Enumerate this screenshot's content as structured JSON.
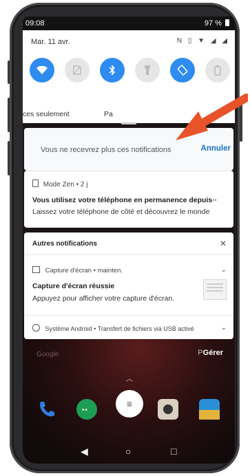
{
  "status_bar": {
    "time": "09:08",
    "battery": "97 %"
  },
  "quick_settings": {
    "date": "Mar. 11 avr.",
    "tiles": [
      {
        "name": "wifi",
        "icon": "wifi-icon",
        "state": "on"
      },
      {
        "name": "sim",
        "icon": "sim-icon",
        "state": "off"
      },
      {
        "name": "bluetooth",
        "icon": "bluetooth-icon",
        "state": "on"
      },
      {
        "name": "flashlight",
        "icon": "flashlight-icon",
        "state": "off"
      },
      {
        "name": "auto-rotate",
        "icon": "rotate-icon",
        "state": "on"
      },
      {
        "name": "battery-saver",
        "icon": "battery-saver-icon",
        "state": "off"
      }
    ],
    "labels": [
      "ces seulement",
      "Pa"
    ]
  },
  "muted_notification": {
    "message": "Vous ne recevrez plus ces notifications",
    "undo_label": "Annuler"
  },
  "zen_notification": {
    "app": "Mode Zen",
    "time": "2 j",
    "title": "Vous utilisez votre téléphone en permanence depuis··",
    "body": "Laissez votre téléphone de côté et découvrez le monde"
  },
  "other_notifications": {
    "header": "Autres notifications",
    "screenshot": {
      "app": "Capture d'écran",
      "time": "mainten.",
      "title": "Capture d'écran réussie",
      "body": "Appuyez pour afficher votre capture d'écran."
    },
    "system": {
      "app": "Système Android",
      "text": "Transfert de fichiers via USB activé"
    }
  },
  "below_panel": {
    "google_label": "Google",
    "manage_label": "Gérer",
    "p_label": "P"
  },
  "colors": {
    "accent": "#2e8bf0",
    "link": "#1a73c8",
    "arrow": "#e8532a"
  }
}
